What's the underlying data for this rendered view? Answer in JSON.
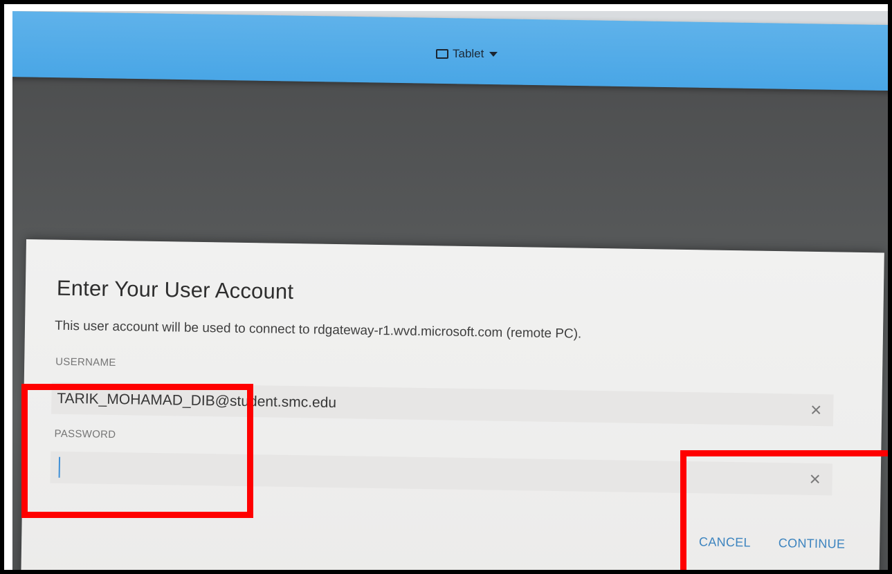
{
  "toolbar": {
    "mode_label": "Tablet",
    "mode_icon": "tablet-icon",
    "dropdown_icon": "caret-down-icon",
    "accent_color": "#4aa7e6"
  },
  "dialog": {
    "title": "Enter Your User Account",
    "description": "This user account will be used to connect to rdgateway-r1.wvd.microsoft.com (remote PC).",
    "username": {
      "label": "USERNAME",
      "value": "TARIK_MOHAMAD_DIB@student.smc.edu",
      "clear_icon": "close-icon"
    },
    "password": {
      "label": "PASSWORD",
      "value": "",
      "clear_icon": "close-icon"
    },
    "actions": {
      "cancel_label": "CANCEL",
      "continue_label": "CONTINUE",
      "action_color": "#3d84bf"
    }
  },
  "annotations": {
    "highlight_color": "#ff0000"
  }
}
